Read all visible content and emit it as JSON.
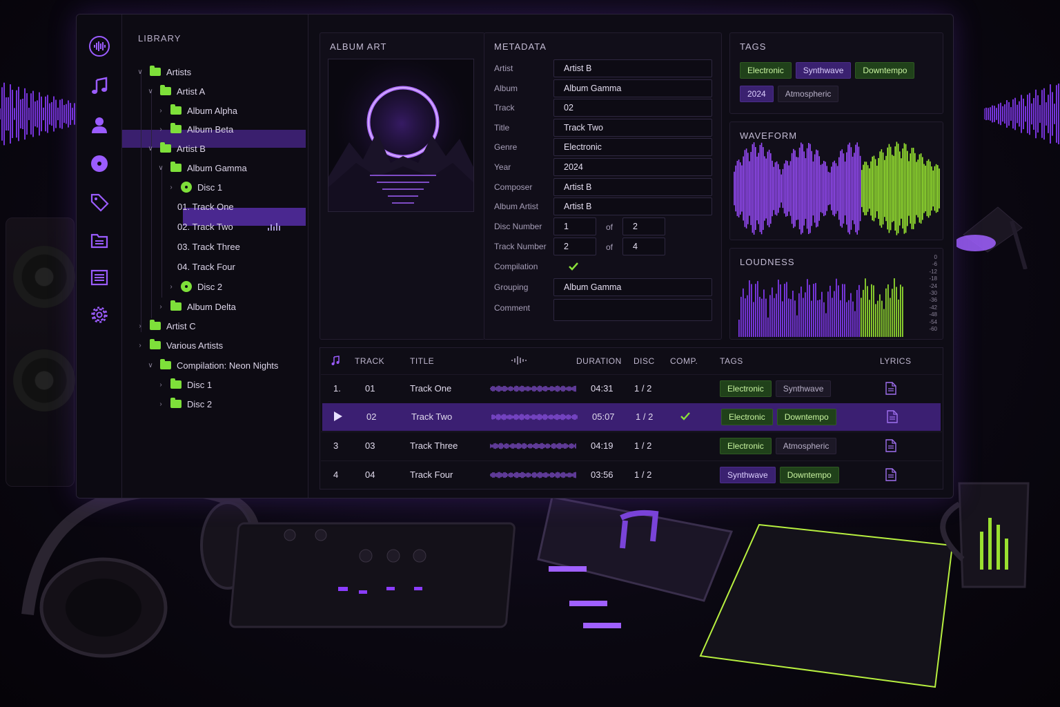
{
  "colors": {
    "accent_purple": "#8b3dff",
    "accent_green": "#7ee03a",
    "selection": "#3b1f72"
  },
  "rail_icons": [
    "waveform-icon",
    "music-note-icon",
    "user-icon",
    "disc-icon",
    "tag-icon",
    "folder-icon",
    "list-icon",
    "gear-icon"
  ],
  "library": {
    "title": "LIBRARY",
    "nodes": [
      {
        "label": "Artists",
        "icon": "folder"
      },
      {
        "label": "Artist A",
        "icon": "folder"
      },
      {
        "label": "Album Alpha",
        "icon": "folder"
      },
      {
        "label": "Album Beta",
        "icon": "folder"
      },
      {
        "label": "Artist B",
        "icon": "folder"
      },
      {
        "label": "Album Gamma",
        "icon": "folder"
      },
      {
        "label": "Disc 1",
        "icon": "disc"
      },
      {
        "label": "01. Track One",
        "icon": "none"
      },
      {
        "label": "02. Track Two",
        "icon": "none"
      },
      {
        "label": "03. Track Three",
        "icon": "none"
      },
      {
        "label": "04. Track Four",
        "icon": "none"
      },
      {
        "label": "Disc 2",
        "icon": "disc"
      },
      {
        "label": "Album Delta",
        "icon": "folder"
      },
      {
        "label": "Artist C",
        "icon": "folder"
      },
      {
        "label": "Various Artists",
        "icon": "folder"
      },
      {
        "label": "Compilation: Neon Nights",
        "icon": "folder"
      },
      {
        "label": "Disc 1",
        "icon": "folder"
      },
      {
        "label": "Disc 2",
        "icon": "folder"
      }
    ]
  },
  "album_art": {
    "title": "ALBUM ART"
  },
  "metadata": {
    "title": "METADATA",
    "fields": [
      {
        "label": "Artist",
        "value": "Artist B"
      },
      {
        "label": "Album",
        "value": "Album Gamma"
      },
      {
        "label": "Track",
        "value": "02"
      },
      {
        "label": "Title",
        "value": "Track Two"
      },
      {
        "label": "Genre",
        "value": "Electronic"
      },
      {
        "label": "Year",
        "value": "2024"
      },
      {
        "label": "Composer",
        "value": "Artist B"
      },
      {
        "label": "Album Artist",
        "value": "Artist B"
      }
    ],
    "disc_number": {
      "label": "Disc Number",
      "value": "1",
      "of": "of",
      "total": "2"
    },
    "track_number": {
      "label": "Track Number",
      "value": "2",
      "of": "of",
      "total": "4"
    },
    "compilation": {
      "label": "Compilation",
      "checked": true
    },
    "grouping": {
      "label": "Grouping",
      "value": "Album Gamma"
    },
    "comment": {
      "label": "Comment",
      "value": ""
    }
  },
  "tags": {
    "title": "TAGS",
    "items": [
      {
        "label": "Electronic",
        "style": "green"
      },
      {
        "label": "Synthwave",
        "style": "purple"
      },
      {
        "label": "Downtempo",
        "style": "green"
      },
      {
        "label": "2024",
        "style": "purple"
      },
      {
        "label": "Atmospheric",
        "style": "gray"
      }
    ]
  },
  "waveform": {
    "title": "WAVEFORM"
  },
  "loudness": {
    "title": "LOUDNESS",
    "scale": [
      "0",
      "-6",
      "-12",
      "-18",
      "-24",
      "-30",
      "-36",
      "-42",
      "-48",
      "-54",
      "-60"
    ]
  },
  "tracks": {
    "headers": {
      "track": "TRACK",
      "title": "TITLE",
      "duration": "DURATION",
      "disc": "DISC",
      "comp": "COMP.",
      "tags": "TAGS",
      "lyrics": "LYRICS"
    },
    "rows": [
      {
        "index": "1.",
        "track": "01",
        "title": "Track One",
        "duration": "04:31",
        "disc": "1 / 2",
        "comp": false,
        "selected": false,
        "tags": [
          {
            "label": "Electronic",
            "style": "green"
          },
          {
            "label": "Synthwave",
            "style": "gray"
          }
        ]
      },
      {
        "index": "",
        "track": "02",
        "title": "Track Two",
        "duration": "05:07",
        "disc": "1 / 2",
        "comp": true,
        "selected": true,
        "tags": [
          {
            "label": "Electronic",
            "style": "green"
          },
          {
            "label": "Downtempo",
            "style": "green"
          }
        ]
      },
      {
        "index": "3",
        "track": "03",
        "title": "Track Three",
        "duration": "04:19",
        "disc": "1 / 2",
        "comp": false,
        "selected": false,
        "tags": [
          {
            "label": "Electronic",
            "style": "green"
          },
          {
            "label": "Atmospheric",
            "style": "gray"
          }
        ]
      },
      {
        "index": "4",
        "track": "04",
        "title": "Track Four",
        "duration": "03:56",
        "disc": "1 / 2",
        "comp": false,
        "selected": false,
        "tags": [
          {
            "label": "Synthwave",
            "style": "purple"
          },
          {
            "label": "Downtempo",
            "style": "green"
          }
        ]
      }
    ]
  }
}
